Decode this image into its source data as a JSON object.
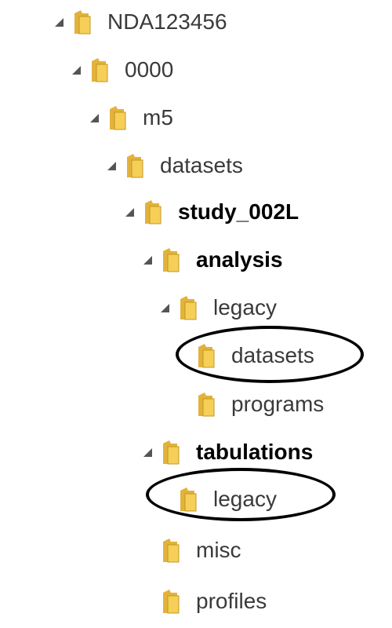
{
  "tree": {
    "nodes": [
      {
        "key": "nda",
        "label": "NDA123456",
        "expanded": true,
        "bold": false
      },
      {
        "key": "n0000",
        "label": "0000",
        "expanded": true,
        "bold": false
      },
      {
        "key": "m5",
        "label": "m5",
        "expanded": true,
        "bold": false
      },
      {
        "key": "datasets",
        "label": "datasets",
        "expanded": true,
        "bold": false
      },
      {
        "key": "study",
        "label": "study_002L",
        "expanded": true,
        "bold": true
      },
      {
        "key": "analysis",
        "label": "analysis",
        "expanded": true,
        "bold": true
      },
      {
        "key": "analysis-legacy",
        "label": "legacy",
        "expanded": true,
        "bold": false
      },
      {
        "key": "legacy-datasets",
        "label": "datasets",
        "expanded": null,
        "bold": false,
        "highlighted": true
      },
      {
        "key": "legacy-programs",
        "label": "programs",
        "expanded": null,
        "bold": false
      },
      {
        "key": "tabulations",
        "label": "tabulations",
        "expanded": true,
        "bold": true
      },
      {
        "key": "tabulations-legacy",
        "label": "legacy",
        "expanded": null,
        "bold": false,
        "highlighted": true
      },
      {
        "key": "misc",
        "label": "misc",
        "expanded": null,
        "bold": false
      },
      {
        "key": "profiles",
        "label": "profiles",
        "expanded": null,
        "bold": false
      }
    ]
  },
  "colors": {
    "folder_front": "#f5cf58",
    "folder_back": "#e2b23a",
    "folder_edge": "#c49722",
    "caret": "#555555",
    "text": "#3a3a3a",
    "highlight_outline": "#000000"
  },
  "icons": {
    "folder": "folder-icon",
    "expander": "expand-arrow-icon"
  }
}
